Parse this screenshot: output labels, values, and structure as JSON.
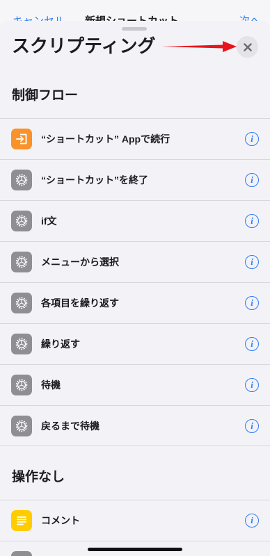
{
  "background_nav": {
    "left": "キャンセル",
    "title": "新規ショートカット",
    "right": "次へ"
  },
  "sheet": {
    "title": "スクリプティング"
  },
  "sections": [
    {
      "header": "制御フロー",
      "items": [
        {
          "label": "“ショートカット” Appで続行",
          "icon": "open-app-icon",
          "icon_color": "#f9922a"
        },
        {
          "label": "“ショートカット”を終了",
          "icon": "gear-icon",
          "icon_color": "#8e8e93"
        },
        {
          "label": "if文",
          "icon": "gear-icon",
          "icon_color": "#8e8e93"
        },
        {
          "label": "メニューから選択",
          "icon": "gear-icon",
          "icon_color": "#8e8e93"
        },
        {
          "label": "各項目を繰り返す",
          "icon": "gear-icon",
          "icon_color": "#8e8e93"
        },
        {
          "label": "繰り返す",
          "icon": "gear-icon",
          "icon_color": "#8e8e93"
        },
        {
          "label": "待機",
          "icon": "gear-icon",
          "icon_color": "#8e8e93"
        },
        {
          "label": "戻るまで待機",
          "icon": "gear-icon",
          "icon_color": "#8e8e93"
        }
      ]
    },
    {
      "header": "操作なし",
      "items": [
        {
          "label": "コメント",
          "icon": "comment-lines-icon",
          "icon_color": "#ffcc00"
        }
      ]
    }
  ],
  "info_glyph": "i",
  "colors": {
    "accent": "#2f7cf6",
    "annotation_arrow": "#e8141c"
  }
}
